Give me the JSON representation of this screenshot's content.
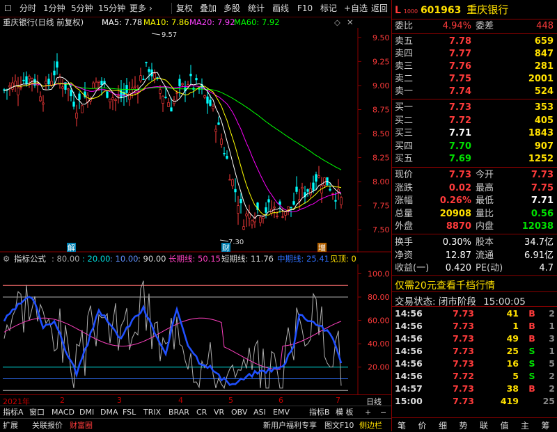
{
  "toolbar": {
    "items": [
      "分时",
      "1分钟",
      "5分钟",
      "15分钟",
      "更多",
      "复权",
      "叠加",
      "多股",
      "统计",
      "画线",
      "F10",
      "标记",
      "+自选",
      "返回"
    ],
    "more_arrow": "›"
  },
  "ma_title": {
    "stock": "重庆银行(日线 前复权)",
    "ma5": "MA5: 7.78",
    "ma10": "MA10: 7.86",
    "ma20": "MA20: 7.92",
    "ma60": "MA60: 7.92"
  },
  "price_axis": [
    "9.50",
    "9.25",
    "9.00",
    "8.75",
    "8.50",
    "8.25",
    "8.00",
    "7.75",
    "7.50"
  ],
  "annotations": {
    "high": "9.57",
    "low": "7.30",
    "mark_jie": "解",
    "mark_cai": "财",
    "mark_zeng": "增"
  },
  "indicator_title": {
    "name": "指标公式",
    "p1": ": 80.00",
    "p2": ": 20.00",
    "p3": ": 10.00",
    "p4": ": 90.00",
    "long": "长期线: 50.15",
    "short": "短期线: 11.76",
    "mid": "中期线: 25.41",
    "top": "见顶: 0"
  },
  "ind_axis": [
    "100.0",
    "80.00",
    "60.00",
    "40.00",
    "20.00"
  ],
  "dates": [
    "2021年",
    "2",
    "3",
    "4",
    "5",
    "6",
    "7"
  ],
  "dates_right": "日线",
  "tabs": [
    "指标A",
    "窗口",
    "MACD",
    "DMI",
    "DMA",
    "FSL",
    "TRIX",
    "BRAR",
    "CR",
    "VR",
    "OBV",
    "ASI",
    "EMV",
    "指标B",
    "模 板",
    "+",
    "−"
  ],
  "bottom_bar": [
    "扩展",
    "关联报价",
    "财富圈",
    "新用户福利专享",
    "图文F10",
    "侧边栏"
  ],
  "right_panel": {
    "marker": "L",
    "marker_sub": "1000",
    "code": "601963",
    "name": "重庆银行",
    "weibi_label": "委比",
    "weibi_value": "4.94%",
    "weicha_label": "委差",
    "weicha_value": "448",
    "asks": [
      {
        "label": "卖五",
        "price": "7.78",
        "vol": "659"
      },
      {
        "label": "卖四",
        "price": "7.77",
        "vol": "847"
      },
      {
        "label": "卖三",
        "price": "7.76",
        "vol": "281"
      },
      {
        "label": "卖二",
        "price": "7.75",
        "vol": "2001"
      },
      {
        "label": "卖一",
        "price": "7.74",
        "vol": "524"
      }
    ],
    "bids": [
      {
        "label": "买一",
        "price": "7.73",
        "vol": "353"
      },
      {
        "label": "买二",
        "price": "7.72",
        "vol": "405"
      },
      {
        "label": "买三",
        "price": "7.71",
        "vol": "1843"
      },
      {
        "label": "买四",
        "price": "7.70",
        "vol": "907"
      },
      {
        "label": "买五",
        "price": "7.69",
        "vol": "1252"
      }
    ],
    "quote": [
      {
        "l1": "现价",
        "v1": "7.73",
        "l2": "今开",
        "v2": "7.73"
      },
      {
        "l1": "涨跌",
        "v1": "0.02",
        "l2": "最高",
        "v2": "7.75"
      },
      {
        "l1": "涨幅",
        "v1": "0.26%",
        "l2": "最低",
        "v2": "7.71"
      },
      {
        "l1": "总量",
        "v1": "20908",
        "l2": "量比",
        "v2": "0.56"
      },
      {
        "l1": "外盘",
        "v1": "8870",
        "l2": "内盘",
        "v2": "12038"
      }
    ],
    "fund": [
      {
        "l1": "换手",
        "v1": "0.30%",
        "l2": "股本",
        "v2": "34.7亿"
      },
      {
        "l1": "净资",
        "v1": "12.87",
        "l2": "流通",
        "v2": "6.91亿"
      },
      {
        "l1": "收益(一)",
        "v1": "0.420",
        "l2": "PE(动)",
        "v2": "4.7"
      }
    ],
    "promo": "仅需20元查看千档行情",
    "status_label": "交易状态:",
    "status_value": "闭市阶段",
    "status_time": "15:00:05",
    "ticks": [
      {
        "t": "14:56",
        "p": "7.73",
        "v": "41",
        "f": "B",
        "n": "2"
      },
      {
        "t": "14:56",
        "p": "7.73",
        "v": "1",
        "f": "B",
        "n": "1"
      },
      {
        "t": "14:56",
        "p": "7.73",
        "v": "49",
        "f": "B",
        "n": "3"
      },
      {
        "t": "14:56",
        "p": "7.73",
        "v": "25",
        "f": "S",
        "n": "1"
      },
      {
        "t": "14:56",
        "p": "7.73",
        "v": "16",
        "f": "S",
        "n": "5"
      },
      {
        "t": "14:56",
        "p": "7.72",
        "v": "5",
        "f": "S",
        "n": "2"
      },
      {
        "t": "14:57",
        "p": "7.73",
        "v": "38",
        "f": "B",
        "n": "2"
      },
      {
        "t": "15:00",
        "p": "7.73",
        "v": "419",
        "f": "",
        "n": "25"
      }
    ],
    "bottom_tabs": [
      "笔",
      "价",
      "细",
      "势",
      "联",
      "值",
      "主",
      "筹"
    ]
  },
  "colors": {
    "up": "#ff3b3b",
    "down": "#00e000",
    "ma5": "#ffffff",
    "ma10": "#ffff00",
    "ma20": "#ff00ff",
    "ma60": "#00ff00"
  }
}
